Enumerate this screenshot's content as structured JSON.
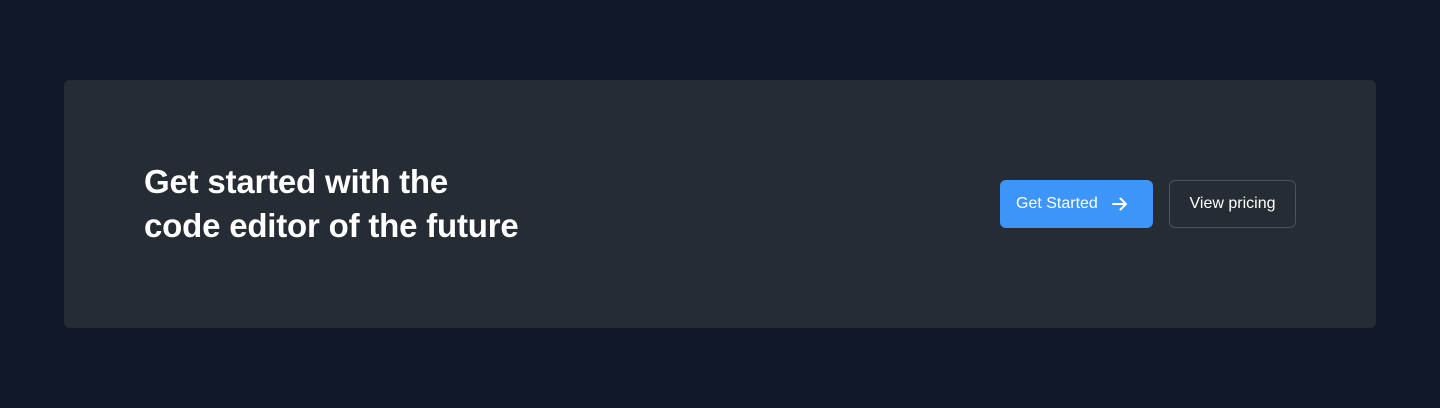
{
  "cta": {
    "heading_line1": "Get started with the",
    "heading_line2": "code editor of the future",
    "primary_label": "Get Started",
    "primary_icon": "arrow-right-icon",
    "secondary_label": "View pricing"
  },
  "colors": {
    "page_background": "#111827",
    "card_background": "#252c33",
    "primary_button": "#3d95f7",
    "secondary_border": "#4b5360",
    "text": "#ffffff"
  }
}
